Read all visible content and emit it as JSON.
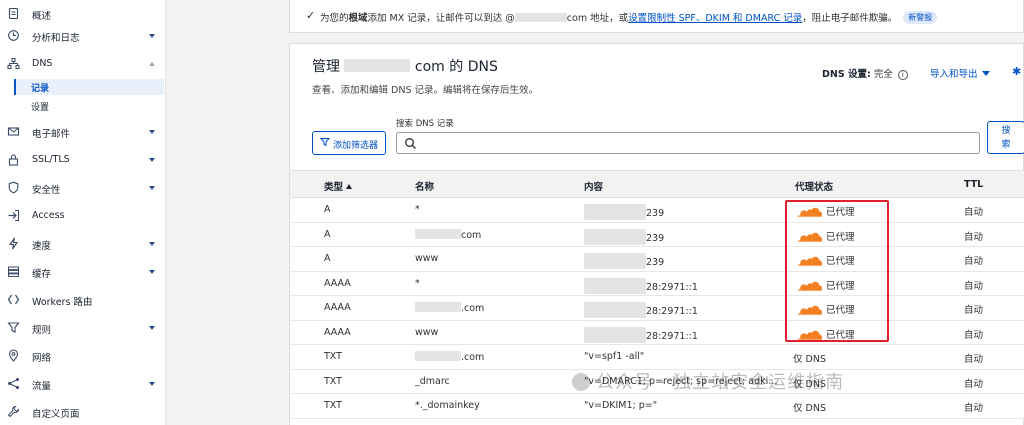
{
  "sidebar": {
    "items": [
      {
        "label": "概述",
        "icon": "document-icon",
        "chevron": ""
      },
      {
        "label": "分析和日志",
        "icon": "clock-icon",
        "chevron": "down"
      },
      {
        "label": "DNS",
        "icon": "network-icon",
        "chevron": "up"
      },
      {
        "label": "电子邮件",
        "icon": "mail-icon",
        "chevron": "down"
      },
      {
        "label": "SSL/TLS",
        "icon": "lock-icon",
        "chevron": "down"
      },
      {
        "label": "安全性",
        "icon": "shield-icon",
        "chevron": "down"
      },
      {
        "label": "Access",
        "icon": "access-icon",
        "chevron": ""
      },
      {
        "label": "速度",
        "icon": "lightning-icon",
        "chevron": "down"
      },
      {
        "label": "缓存",
        "icon": "stack-icon",
        "chevron": "down"
      },
      {
        "label": "Workers 路由",
        "icon": "workers-icon",
        "chevron": ""
      },
      {
        "label": "规则",
        "icon": "funnel-icon",
        "chevron": "down"
      },
      {
        "label": "网络",
        "icon": "pin-icon",
        "chevron": ""
      },
      {
        "label": "流量",
        "icon": "share-icon",
        "chevron": "down"
      },
      {
        "label": "自定义页面",
        "icon": "wrench-icon",
        "chevron": ""
      }
    ],
    "dns_sub": [
      {
        "label": "记录",
        "active": true
      },
      {
        "label": "设置",
        "active": false
      }
    ]
  },
  "notice": {
    "text_pre": "为您的",
    "text_bold": "根域",
    "text_mid": "添加 MX 记录，让邮件可以到达 @",
    "text_domain": "com 地址，或",
    "link": "设置限制性 SPF、DKIM 和 DMARC 记录",
    "text_post": "，阻止电子邮件欺骗。",
    "badge": "新警报"
  },
  "card": {
    "title_pre": "管理",
    "title_post": "com 的 DNS",
    "subtitle": "查看、添加和编辑 DNS 记录。编辑将在保存后生效。",
    "dns_setting_label": "DNS 设置:",
    "dns_setting_value": "完全",
    "import_export": "导入和导出",
    "filter_button": "添加筛选器",
    "search_label": "搜索 DNS 记录",
    "search_button": "搜\n索"
  },
  "table": {
    "headers": {
      "type": "类型",
      "name": "名称",
      "content": "内容",
      "proxy": "代理状态",
      "ttl": "TTL"
    },
    "rows": [
      {
        "type": "A",
        "name": "*",
        "name_redacted": false,
        "content": "239",
        "content_redacted": true,
        "proxy": "已代理",
        "proxied": true,
        "ttl": "自动"
      },
      {
        "type": "A",
        "name": "com",
        "name_redacted": true,
        "content": "239",
        "content_redacted": true,
        "proxy": "已代理",
        "proxied": true,
        "ttl": "自动"
      },
      {
        "type": "A",
        "name": "www",
        "name_redacted": false,
        "content": "239",
        "content_redacted": true,
        "proxy": "已代理",
        "proxied": true,
        "ttl": "自动"
      },
      {
        "type": "AAAA",
        "name": "*",
        "name_redacted": false,
        "content": "28:2971::1",
        "content_redacted": true,
        "proxy": "已代理",
        "proxied": true,
        "ttl": "自动"
      },
      {
        "type": "AAAA",
        "name": ".com",
        "name_redacted": true,
        "content": "28:2971::1",
        "content_redacted": true,
        "proxy": "已代理",
        "proxied": true,
        "ttl": "自动"
      },
      {
        "type": "AAAA",
        "name": "www",
        "name_redacted": false,
        "content": "28:2971::1",
        "content_redacted": true,
        "proxy": "已代理",
        "proxied": true,
        "ttl": "自动"
      },
      {
        "type": "TXT",
        "name": ".com",
        "name_redacted": true,
        "content": "\"v=spf1 -all\"",
        "content_redacted": false,
        "proxy": "仅 DNS",
        "proxied": false,
        "ttl": "自动"
      },
      {
        "type": "TXT",
        "name": "_dmarc",
        "name_redacted": false,
        "content": "\"v=DMARC1; p=reject; sp=reject; adki...",
        "content_redacted": false,
        "proxy": "仅 DNS",
        "proxied": false,
        "ttl": "自动"
      },
      {
        "type": "TXT",
        "name": "*._domainkey",
        "name_redacted": false,
        "content": "\"v=DKIM1; p=\"",
        "content_redacted": false,
        "proxy": "仅 DNS",
        "proxied": false,
        "ttl": "自动"
      }
    ]
  },
  "watermark": "公众号 · 独立站安全运维指南",
  "colors": {
    "accent": "#0051c3",
    "cloud": "#f38020",
    "highlight": "#e0212d"
  }
}
